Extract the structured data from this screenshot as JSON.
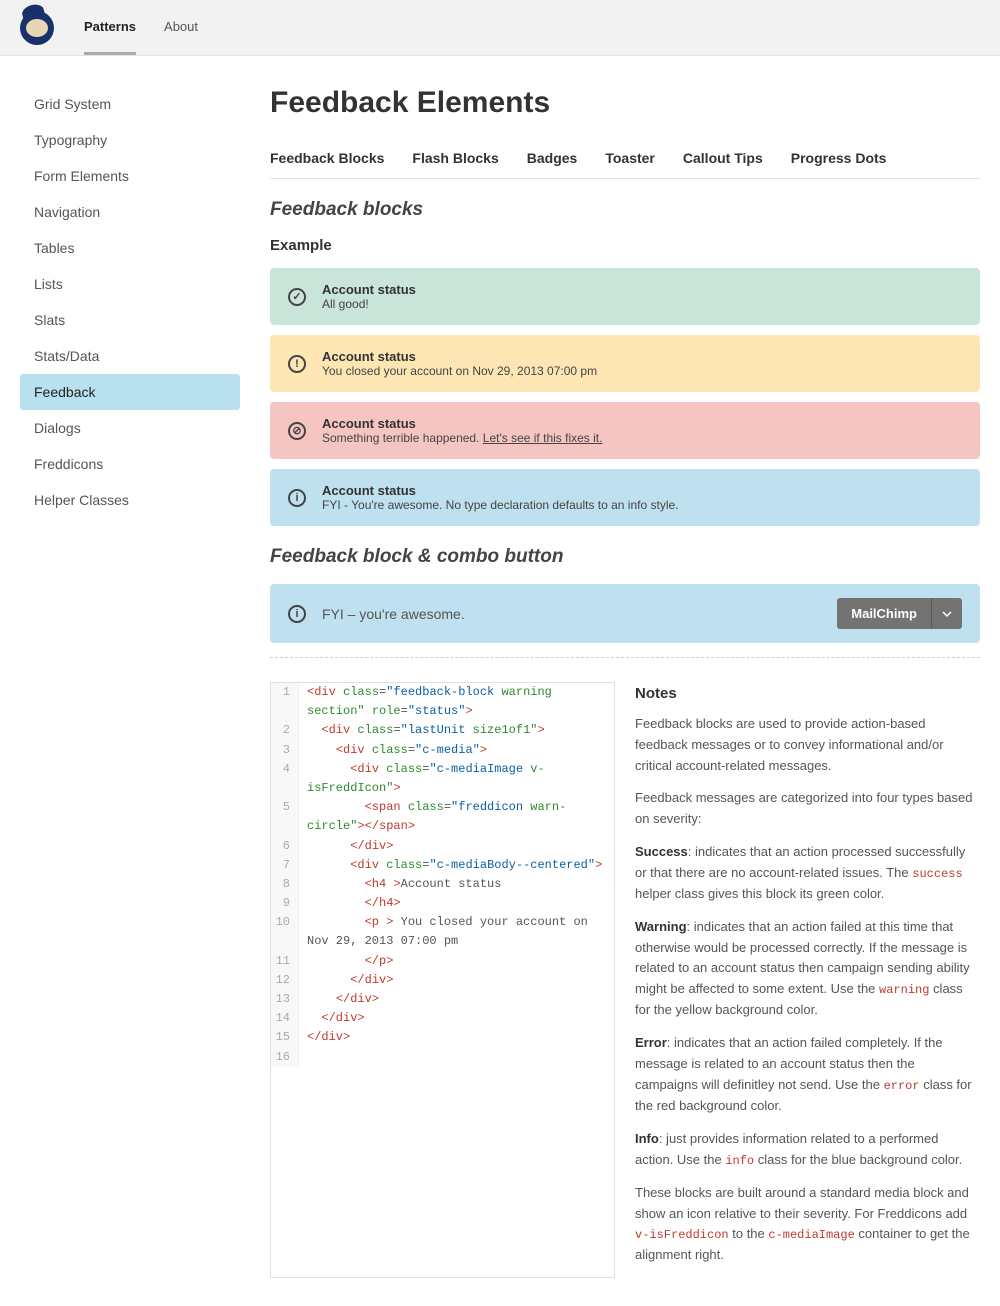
{
  "topnav": {
    "items": [
      "Patterns",
      "About"
    ],
    "active": 0
  },
  "sidebar": {
    "items": [
      "Grid System",
      "Typography",
      "Form Elements",
      "Navigation",
      "Tables",
      "Lists",
      "Slats",
      "Stats/Data",
      "Feedback",
      "Dialogs",
      "Freddicons",
      "Helper Classes"
    ],
    "active": 8
  },
  "page": {
    "title": "Feedback Elements"
  },
  "tabs": [
    "Feedback Blocks",
    "Flash Blocks",
    "Badges",
    "Toaster",
    "Callout Tips",
    "Progress Dots"
  ],
  "sections": {
    "feedback_blocks_title": "Feedback blocks",
    "example_title": "Example",
    "combo_title": "Feedback block & combo button"
  },
  "blocks": {
    "success": {
      "title": "Account status",
      "text": "All good!"
    },
    "warning": {
      "title": "Account status",
      "text": "You closed your account on Nov 29, 2013 07:00 pm"
    },
    "error": {
      "title": "Account status",
      "text_pre": "Something terrible happened. ",
      "link": "Let's see if this fixes it."
    },
    "info": {
      "title": "Account status",
      "text": "FYI - You're awesome. No type declaration defaults to an info style."
    },
    "combo": {
      "text": "FYI – you're awesome.",
      "button": "MailChimp"
    }
  },
  "code": [
    {
      "n": 1,
      "indent": 0,
      "open": "div",
      "attrs": "class=\"feedback-block warning section\" role=\"status\""
    },
    {
      "n": 2,
      "indent": 1,
      "open": "div",
      "attrs": "class=\"lastUnit size1of1\""
    },
    {
      "n": 3,
      "indent": 2,
      "open": "div",
      "attrs": "class=\"c-media\""
    },
    {
      "n": 4,
      "indent": 3,
      "open": "div",
      "attrs": "class=\"c-mediaImage v-isFreddIcon\""
    },
    {
      "n": 5,
      "indent": 4,
      "selfpair": "span",
      "attrs": "class=\"freddicon warn-circle\""
    },
    {
      "n": 6,
      "indent": 3,
      "close": "div"
    },
    {
      "n": 7,
      "indent": 3,
      "open": "div",
      "attrs": "class=\"c-mediaBody--centered\""
    },
    {
      "n": 8,
      "indent": 4,
      "open": "h4",
      "text": "Account status"
    },
    {
      "n": 9,
      "indent": 4,
      "close": "h4"
    },
    {
      "n": 10,
      "indent": 4,
      "open": "p",
      "text": " You closed your account on Nov 29, 2013 07:00 pm"
    },
    {
      "n": 11,
      "indent": 4,
      "close": "p"
    },
    {
      "n": 12,
      "indent": 3,
      "close": "div"
    },
    {
      "n": 13,
      "indent": 2,
      "close": "div"
    },
    {
      "n": 14,
      "indent": 1,
      "close": "div"
    },
    {
      "n": 15,
      "indent": 0,
      "close": "div"
    },
    {
      "n": 16,
      "indent": 0
    }
  ],
  "notes": {
    "title": "Notes",
    "p1": "Feedback blocks are used to provide action-based feedback messages or to convey informational and/or critical account-related messages.",
    "p2": "Feedback messages are categorized into four types based on severity:",
    "success_label": "Success",
    "success_text_a": ": indicates that an action processed successfully or that there are no account-related issues. The ",
    "success_code": "success",
    "success_text_b": " helper class gives this block its green color.",
    "warning_label": "Warning",
    "warning_text_a": ": indicates that an action failed at this time that otherwise would be processed correctly. If the message is related to an account status then campaign sending ability might be affected to some extent. Use the ",
    "warning_code": "warning",
    "warning_text_b": " class for the yellow background color.",
    "error_label": "Error",
    "error_text_a": ": indicates that an action failed completely. If the message is related to an account status then the campaigns will definitley not send. Use the ",
    "error_code": "error",
    "error_text_b": " class for the red background color.",
    "info_label": "Info",
    "info_text_a": ": just provides information related to a performed action. Use the ",
    "info_code": "info",
    "info_text_b": " class for the blue background color.",
    "p7_a": "These blocks are built around a standard media block and show an icon relative to their severity. For Freddicons add ",
    "p7_code1": "v-isFreddicon",
    "p7_b": " to the ",
    "p7_code2": "c-mediaImage",
    "p7_c": " container to get the alignment right."
  }
}
